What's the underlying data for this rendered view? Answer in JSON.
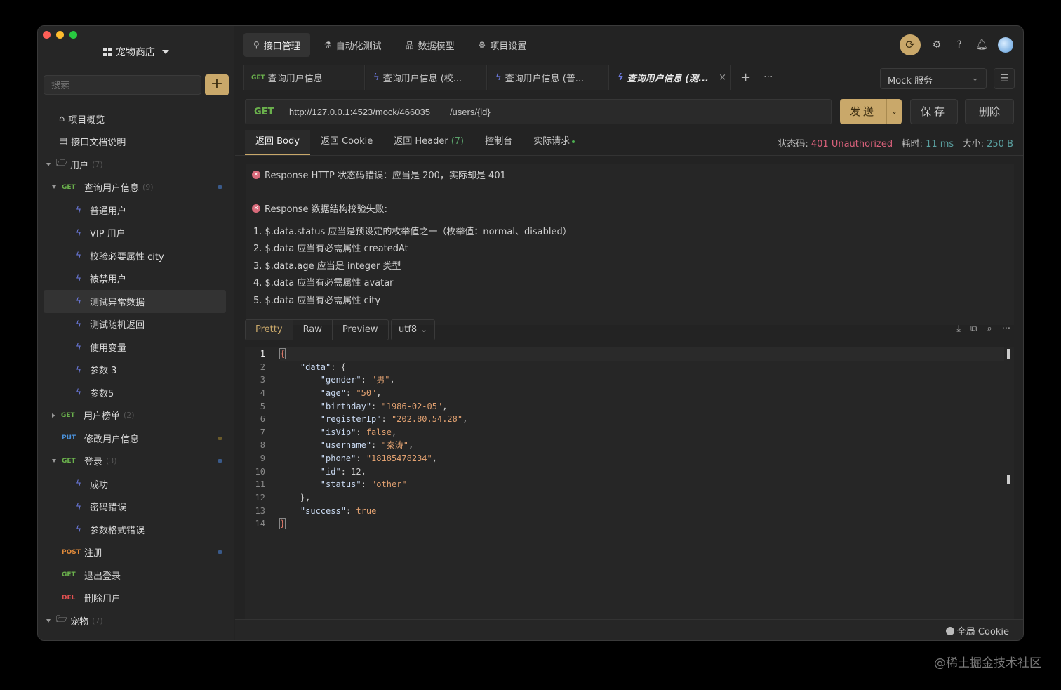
{
  "sidebar": {
    "project": "宠物商店",
    "search_placeholder": "搜索",
    "add_label": "+",
    "tree": [
      {
        "type": "page",
        "icon": "⌂",
        "label": "项目概览"
      },
      {
        "type": "page",
        "icon": "▤",
        "label": "接口文档说明"
      },
      {
        "type": "folder",
        "label": "用户",
        "count": "(7)"
      },
      {
        "type": "api",
        "method": "GET",
        "label": "查询用户信息",
        "count": "(9)",
        "dot": "b"
      },
      {
        "type": "case",
        "label": "普通用户"
      },
      {
        "type": "case",
        "label": "VIP 用户"
      },
      {
        "type": "case",
        "label": "校验必要属性 city"
      },
      {
        "type": "case",
        "label": "被禁用户"
      },
      {
        "type": "case",
        "label": "测试异常数据",
        "active": true
      },
      {
        "type": "case",
        "label": "测试随机返回"
      },
      {
        "type": "case",
        "label": "使用变量"
      },
      {
        "type": "case",
        "label": "参数 3"
      },
      {
        "type": "case",
        "label": "参数5"
      },
      {
        "type": "api",
        "method": "GET",
        "label": "用户榜单",
        "count": "(2)",
        "collapsed": true
      },
      {
        "type": "api",
        "method": "PUT",
        "label": "修改用户信息",
        "dot": "y",
        "noarrow": true
      },
      {
        "type": "api",
        "method": "GET",
        "label": "登录",
        "count": "(3)",
        "dot": "b"
      },
      {
        "type": "case",
        "label": "成功"
      },
      {
        "type": "case",
        "label": "密码错误"
      },
      {
        "type": "case",
        "label": "参数格式错误"
      },
      {
        "type": "api",
        "method": "POST",
        "label": "注册",
        "dot": "b",
        "noarrow": true
      },
      {
        "type": "api",
        "method": "GET",
        "label": "退出登录",
        "noarrow": true
      },
      {
        "type": "api",
        "method": "DEL",
        "label": "删除用户",
        "noarrow": true
      },
      {
        "type": "folder",
        "label": "宠物",
        "count": "(7)"
      }
    ]
  },
  "topnav": [
    {
      "icon": "⚲",
      "label": "接口管理",
      "on": true
    },
    {
      "icon": "⚗",
      "label": "自动化测试"
    },
    {
      "icon": "品",
      "label": "数据模型"
    },
    {
      "icon": "⚙",
      "label": "项目设置"
    }
  ],
  "tabs": [
    {
      "method": "GET",
      "label": "查询用户信息"
    },
    {
      "label": "查询用户信息 (校..."
    },
    {
      "label": "查询用户信息 (普..."
    },
    {
      "label": "查询用户信息 (测...",
      "on": true
    }
  ],
  "tab_plus": "+",
  "tab_more": "···",
  "mock": "Mock 服务",
  "request": {
    "method": "GET",
    "base_url": "http://127.0.0.1:4523/mock/466035",
    "path": "/users/{id}"
  },
  "buttons": {
    "send": "发送",
    "save": "保存",
    "delete": "删除"
  },
  "resp_tabs": [
    {
      "label": "返回 Body",
      "on": true
    },
    {
      "label": "返回 Cookie"
    },
    {
      "label": "返回 Header",
      "extra": "(7)"
    },
    {
      "label": "控制台"
    },
    {
      "label": "实际请求",
      "dot": true
    }
  ],
  "stats": {
    "status_label": "状态码:",
    "status_value": "401 Unauthorized",
    "time_label": "耗时:",
    "time_value": "11 ms",
    "size_label": "大小:",
    "size_value": "250 B"
  },
  "errors": {
    "http_error": "Response HTTP 状态码错误：应当是 200，实际却是 401",
    "schema_error": "Response 数据结构校验失败:",
    "items": [
      "1. $.data.status 应当是预设定的枚举值之一（枚举值：normal、disabled）",
      "2. $.data 应当有必需属性 createdAt",
      "3. $.data.age 应当是 integer 类型",
      "4. $.data 应当有必需属性 avatar",
      "5. $.data 应当有必需属性 city"
    ]
  },
  "view_tabs": [
    {
      "label": "Pretty",
      "on": true
    },
    {
      "label": "Raw"
    },
    {
      "label": "Preview"
    }
  ],
  "encoding": "utf8",
  "code_lines": [
    [
      {
        "t": "b",
        "v": "{"
      }
    ],
    [
      {
        "t": "n",
        "v": "    "
      },
      {
        "t": "k",
        "v": "\"data\""
      },
      {
        "t": "n",
        "v": ": {"
      }
    ],
    [
      {
        "t": "n",
        "v": "        "
      },
      {
        "t": "k",
        "v": "\"gender\""
      },
      {
        "t": "n",
        "v": ": "
      },
      {
        "t": "s",
        "v": "\"男\""
      },
      {
        "t": "n",
        "v": ","
      }
    ],
    [
      {
        "t": "n",
        "v": "        "
      },
      {
        "t": "k",
        "v": "\"age\""
      },
      {
        "t": "n",
        "v": ": "
      },
      {
        "t": "s",
        "v": "\"50\""
      },
      {
        "t": "n",
        "v": ","
      }
    ],
    [
      {
        "t": "n",
        "v": "        "
      },
      {
        "t": "k",
        "v": "\"birthday\""
      },
      {
        "t": "n",
        "v": ": "
      },
      {
        "t": "s",
        "v": "\"1986-02-05\""
      },
      {
        "t": "n",
        "v": ","
      }
    ],
    [
      {
        "t": "n",
        "v": "        "
      },
      {
        "t": "k",
        "v": "\"registerIp\""
      },
      {
        "t": "n",
        "v": ": "
      },
      {
        "t": "s",
        "v": "\"202.80.54.28\""
      },
      {
        "t": "n",
        "v": ","
      }
    ],
    [
      {
        "t": "n",
        "v": "        "
      },
      {
        "t": "k",
        "v": "\"isVip\""
      },
      {
        "t": "n",
        "v": ": "
      },
      {
        "t": "s",
        "v": "false"
      },
      {
        "t": "n",
        "v": ","
      }
    ],
    [
      {
        "t": "n",
        "v": "        "
      },
      {
        "t": "k",
        "v": "\"username\""
      },
      {
        "t": "n",
        "v": ": "
      },
      {
        "t": "s",
        "v": "\"秦涛\""
      },
      {
        "t": "n",
        "v": ","
      }
    ],
    [
      {
        "t": "n",
        "v": "        "
      },
      {
        "t": "k",
        "v": "\"phone\""
      },
      {
        "t": "n",
        "v": ": "
      },
      {
        "t": "s",
        "v": "\"18185478234\""
      },
      {
        "t": "n",
        "v": ","
      }
    ],
    [
      {
        "t": "n",
        "v": "        "
      },
      {
        "t": "k",
        "v": "\"id\""
      },
      {
        "t": "n",
        "v": ": 12,"
      }
    ],
    [
      {
        "t": "n",
        "v": "        "
      },
      {
        "t": "k",
        "v": "\"status\""
      },
      {
        "t": "n",
        "v": ": "
      },
      {
        "t": "s",
        "v": "\"other\""
      }
    ],
    [
      {
        "t": "n",
        "v": "    },"
      }
    ],
    [
      {
        "t": "n",
        "v": "    "
      },
      {
        "t": "k",
        "v": "\"success\""
      },
      {
        "t": "n",
        "v": ": "
      },
      {
        "t": "s",
        "v": "true"
      }
    ],
    [
      {
        "t": "b",
        "v": "}"
      }
    ]
  ],
  "footer": {
    "cookie": "全局 Cookie"
  },
  "watermark": "@稀土掘金技术社区",
  "colors": {
    "accent": "#c9a86a",
    "get": "#6ab04c",
    "error": "#d8607a"
  }
}
